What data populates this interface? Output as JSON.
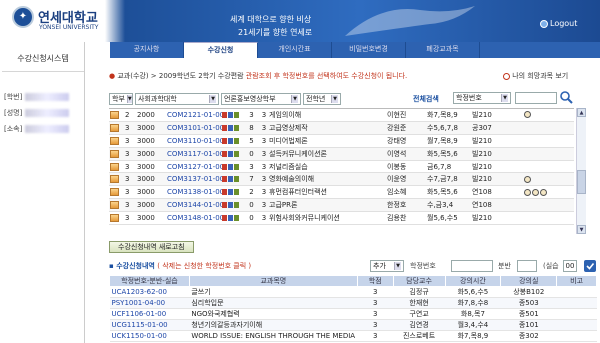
{
  "header": {
    "logo_kr": "연세대학교",
    "logo_en": "YONSEI UNIVERSITY",
    "slogan_line1": "세계 대학으로 향한 비상",
    "slogan_line2": "21세기를 향한 연세로",
    "logout": "Logout"
  },
  "sidebar": {
    "title": "수강신청시스템",
    "fields": [
      {
        "label": "[학번]"
      },
      {
        "label": "[성명]"
      },
      {
        "label": "[소속]"
      }
    ]
  },
  "tabs": [
    {
      "label": "공지사항",
      "active": false
    },
    {
      "label": "수강신청",
      "active": true
    },
    {
      "label": "개인시간표",
      "active": false
    },
    {
      "label": "비밀번호변경",
      "active": false
    },
    {
      "label": "폐강교과목",
      "active": false
    }
  ],
  "breadcrumb": {
    "path": "교과(수강) > 2009학년도 2학기 수강편람",
    "warning": "관람조회 후 학정번호를 선택하여도 수강신청이 됩니다."
  },
  "my_wishlist": "나의 희망과목 보기",
  "filters": {
    "level": "학부",
    "college": "사회과학대학",
    "department": "언론홍보영상학부",
    "year": "전학년",
    "full_search": "전체검색",
    "course_code_select": "학정번호"
  },
  "course_list": [
    {
      "n": "2",
      "grade": "2000",
      "code": "COM2121-01-00",
      "cred": "3",
      "cap": "3",
      "name": "게임의이해",
      "prof": "이현진",
      "time": "화7,목8,9",
      "room": "빌210"
    },
    {
      "n": "3",
      "grade": "3000",
      "code": "COM3101-01-00",
      "cred": "8",
      "cap": "3",
      "name": "고급영상제작",
      "prof": "강원준",
      "time": "수5,6,7,8",
      "room": "공307"
    },
    {
      "n": "3",
      "grade": "3000",
      "code": "COM3110-01-00",
      "cred": "5",
      "cap": "3",
      "name": "미디어법제론",
      "prof": "강태영",
      "time": "월7,목8,9",
      "room": "빌210"
    },
    {
      "n": "3",
      "grade": "3000",
      "code": "COM3117-01-00",
      "cred": "0",
      "cap": "3",
      "name": "설득커뮤니케이션론",
      "prof": "이영석",
      "time": "화5,목5,6",
      "room": "빌210"
    },
    {
      "n": "3",
      "grade": "3000",
      "code": "COM3127-01-00",
      "cred": "3",
      "cap": "3",
      "name": "저널리즘실습",
      "prof": "이봉동",
      "time": "금6,7,8",
      "room": "빌210"
    },
    {
      "n": "3",
      "grade": "3000",
      "code": "COM3137-01-00",
      "cred": "7",
      "cap": "3",
      "name": "영화예술의이해",
      "prof": "이윤영",
      "time": "수7,금7,8",
      "room": "빌210"
    },
    {
      "n": "3",
      "grade": "3000",
      "code": "COM3138-01-00",
      "cred": "2",
      "cap": "3",
      "name": "휴먼컴퓨터인터랙션",
      "prof": "임소혜",
      "time": "화5,목5,6",
      "room": "연108"
    },
    {
      "n": "3",
      "grade": "3000",
      "code": "COM3144-01-00",
      "cred": "0",
      "cap": "3",
      "name": "고급PR론",
      "prof": "한정호",
      "time": "수,금3,4",
      "room": "연108"
    },
    {
      "n": "3",
      "grade": "3000",
      "code": "COM3148-01-00",
      "cred": "0",
      "cap": "3",
      "name": "위험사회와커뮤니케이션",
      "prof": "김용찬",
      "time": "월5,6,수5",
      "room": "빌210"
    }
  ],
  "refresh_button": "수강신청내역 새로고침",
  "registration": {
    "title": "수강신청내역",
    "note": "( 삭제는 신청한 학정번호 클릭 )",
    "add_select": "추가",
    "code_label": "학정번호",
    "section_label": "분반",
    "lab_label": "(실습",
    "lab_value": "00",
    "headers": [
      "학정번호-분반-실습",
      "교과목명",
      "학점",
      "담당교수",
      "강의시간",
      "강의실",
      "비고"
    ],
    "rows": [
      {
        "code": "UCA1203-62-00",
        "name": "글쓰기",
        "cred": "3",
        "prof": "김정규",
        "time": "화5,6,수5",
        "room": "상봉B102",
        "note": ""
      },
      {
        "code": "PSY1001-04-00",
        "name": "심리학입문",
        "cred": "3",
        "prof": "한재현",
        "time": "화7,8,수8",
        "room": "종503",
        "note": ""
      },
      {
        "code": "UCF1106-01-00",
        "name": "NGO와국제협력",
        "cred": "3",
        "prof": "구연교",
        "time": "화8,목7",
        "room": "종501",
        "note": ""
      },
      {
        "code": "UCG1115-01-00",
        "name": "청년기의갈등과자기이해",
        "cred": "3",
        "prof": "김연경",
        "time": "월3,4,수4",
        "room": "종101",
        "note": ""
      },
      {
        "code": "UCK1150-01-00",
        "name": "WORLD ISSUE: ENGLISH THROUGH THE MEDIA",
        "cred": "3",
        "prof": "진스로베트",
        "time": "화7,목8,9",
        "room": "종302",
        "note": ""
      }
    ]
  },
  "colors": {
    "header_blue": "#2d62b1",
    "link_blue": "#1d46a8",
    "warning_red": "#c2341c",
    "table_header": "#c6d4ea"
  }
}
